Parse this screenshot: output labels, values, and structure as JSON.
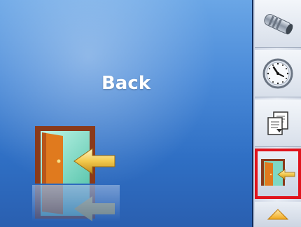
{
  "main": {
    "title": "Back"
  },
  "sidebar": {
    "items": [
      {
        "icon": "connector-icon",
        "selected": false
      },
      {
        "icon": "clock-icon",
        "selected": false
      },
      {
        "icon": "documents-icon",
        "selected": false
      },
      {
        "icon": "exit-door-icon",
        "selected": true
      }
    ],
    "scroll_icon": "arrow-up-icon"
  },
  "colors": {
    "selection_outline": "#e0141c",
    "panel_top": "#6aa6e6",
    "panel_bottom": "#2a5fb0",
    "door_frame": "#8a3a1a",
    "door": "#e07a1e",
    "arrow": "#f2c94c"
  }
}
